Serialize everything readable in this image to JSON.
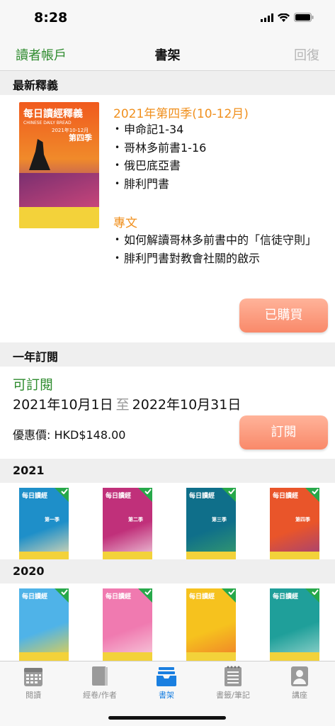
{
  "status_bar": {
    "time": "8:28"
  },
  "nav": {
    "left": "讀者帳戶",
    "title": "書架",
    "right": "回復"
  },
  "latest": {
    "header": "最新釋義",
    "cover": {
      "title": "每日讀經釋義",
      "subtitle": "CHINESE DAILY BREAD",
      "period": "2021年10-12月",
      "season": "第四季"
    },
    "season_title": "2021年第四季(10-12月)",
    "books": [
      "申命記1-34",
      "哥林多前書1-16",
      "俄巴底亞書",
      "腓利門書"
    ],
    "topics_title": "專文",
    "topics": [
      "如何解讀哥林多前書中的「信徒守則」",
      "腓利門書對教會社關的啟示"
    ],
    "button": "已購買"
  },
  "subscription": {
    "header": "一年訂閱",
    "status": "可訂閱",
    "start": "2021年10月1日",
    "to": "至",
    "end": "2022年10月31日",
    "price": "優惠價: HKD$148.00",
    "button": "訂閱"
  },
  "year_2021": {
    "header": "2021",
    "covers": [
      {
        "title": "每日讀經",
        "season": "第一季",
        "colors": [
          "#1e8fc9",
          "#f4e1b0"
        ]
      },
      {
        "title": "每日讀經",
        "season": "第二季",
        "colors": [
          "#c0307a",
          "#f2d6e4"
        ]
      },
      {
        "title": "每日讀經",
        "season": "第三季",
        "colors": [
          "#0f6f8a",
          "#3a9f6a"
        ]
      },
      {
        "title": "每日讀經",
        "season": "第四季",
        "colors": [
          "#e9552a",
          "#9b3f7f"
        ]
      }
    ]
  },
  "year_2020": {
    "header": "2020",
    "covers": [
      {
        "title": "每日讀經",
        "colors": [
          "#4fb3e8",
          "#f5d33c"
        ]
      },
      {
        "title": "每日讀經",
        "colors": [
          "#f07ab0",
          "#f7d2e0"
        ]
      },
      {
        "title": "每日讀經",
        "colors": [
          "#f6c21e",
          "#ef7a2a"
        ]
      },
      {
        "title": "每日讀經",
        "colors": [
          "#1f9f9a",
          "#9fd8d0"
        ]
      }
    ]
  },
  "tabs": [
    {
      "label": "閱讀",
      "icon": "calendar-icon"
    },
    {
      "label": "經卷/作者",
      "icon": "book-icon"
    },
    {
      "label": "書架",
      "icon": "tray-icon"
    },
    {
      "label": "書籤/筆記",
      "icon": "notes-icon"
    },
    {
      "label": "講座",
      "icon": "person-icon"
    }
  ],
  "colors": {
    "accent_green": "#2e8b2e",
    "accent_orange": "#f0901e",
    "tab_active": "#1a7fe0",
    "check_green": "#27a84a"
  }
}
